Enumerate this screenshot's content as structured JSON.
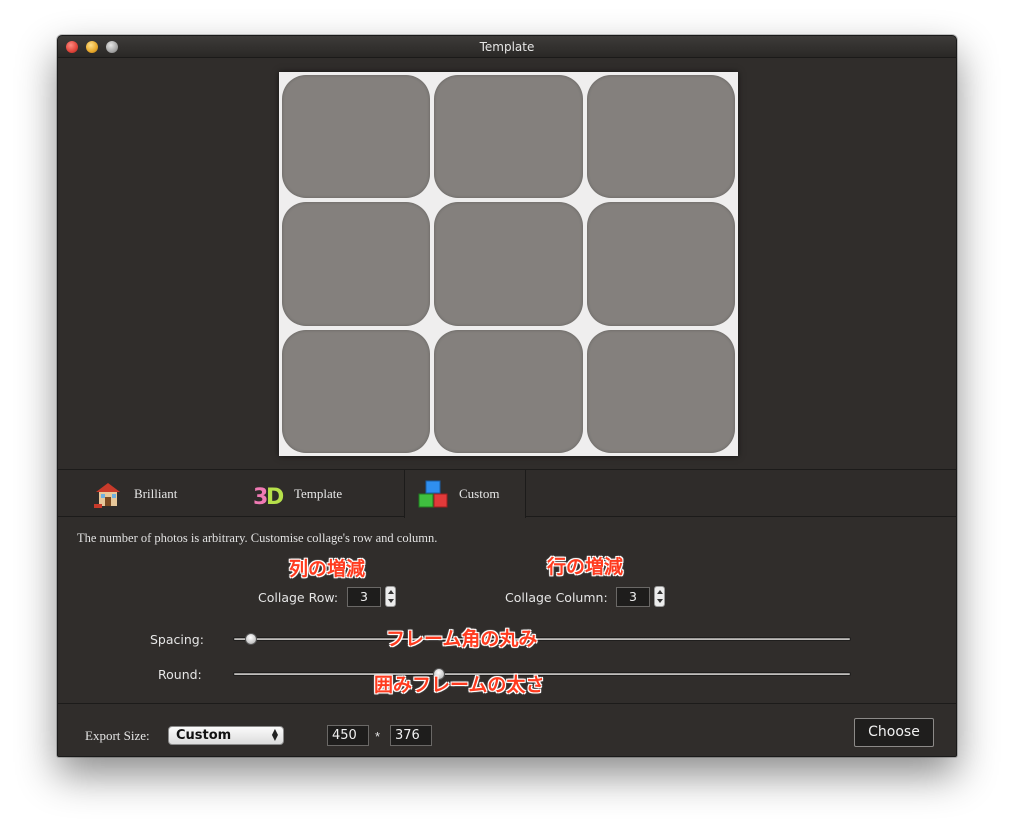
{
  "window": {
    "title": "Template"
  },
  "tabs": [
    {
      "label": "Brilliant",
      "icon": "house-icon"
    },
    {
      "label": "Template",
      "icon": "3d-icon"
    },
    {
      "label": "Custom",
      "icon": "blocks-icon",
      "selected": true
    }
  ],
  "custom": {
    "hint": "The number of photos is arbitrary. Customise collage's row and column.",
    "annotations": {
      "rows": "列の増減",
      "columns": "行の増減",
      "spacing": "フレーム角の丸み",
      "round": "囲みフレームの太さ"
    },
    "collage_row": {
      "label": "Collage Row:",
      "value": "3"
    },
    "collage_column": {
      "label": "Collage Column:",
      "value": "3"
    },
    "spacing": {
      "label": "Spacing:",
      "level": 0.02
    },
    "round": {
      "label": "Round:",
      "level": 0.33
    }
  },
  "export": {
    "label": "Export Size:",
    "preset": "Custom",
    "width": "450",
    "separator": "*",
    "height": "376"
  },
  "choose_button": "Choose",
  "preview": {
    "rows": 3,
    "columns": 3
  }
}
